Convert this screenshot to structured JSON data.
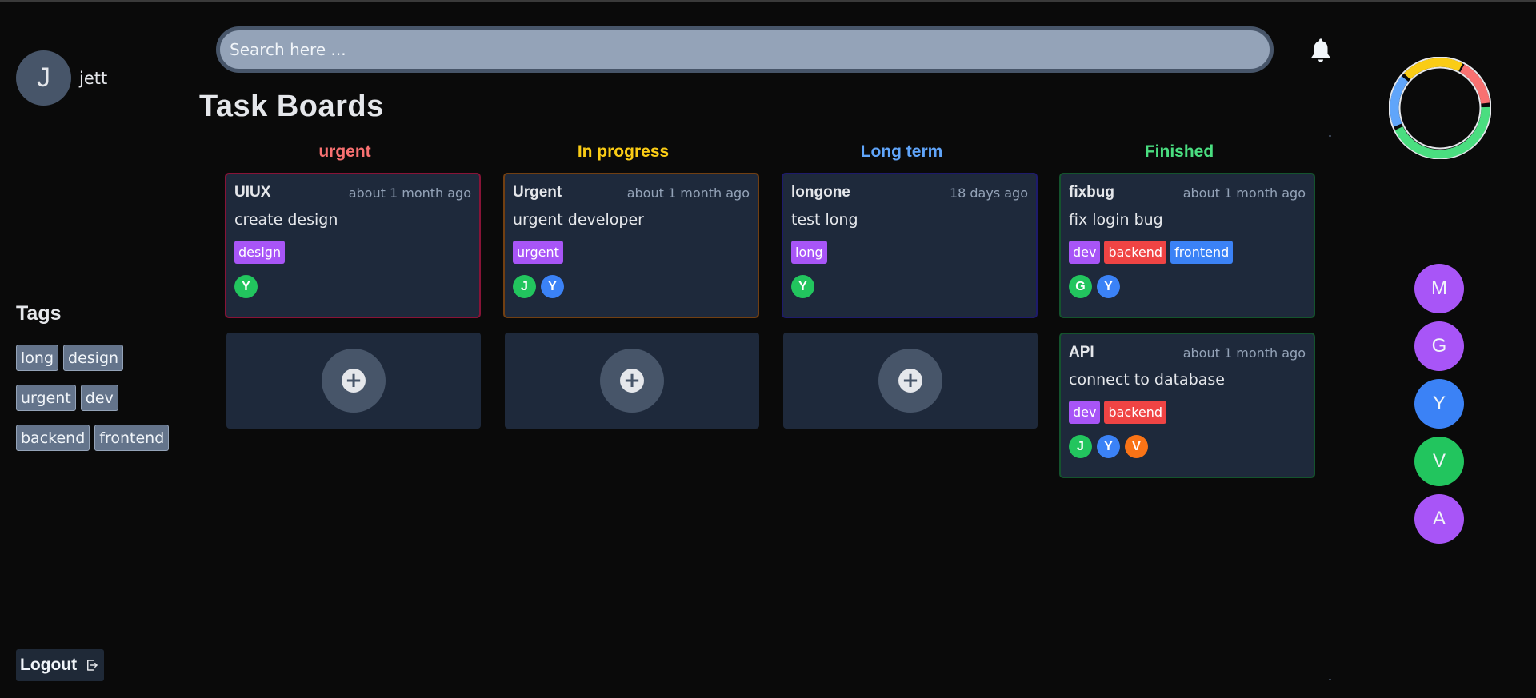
{
  "user": {
    "initial": "J",
    "name": "jett"
  },
  "search": {
    "placeholder": "Search here ..."
  },
  "icons": {
    "notification": "bell-icon",
    "logout": "logout-icon",
    "add": "plus-icon"
  },
  "page_title": "Task Boards",
  "sidebar": {
    "tags_title": "Tags",
    "tags": [
      "long",
      "design",
      "urgent",
      "dev",
      "backend",
      "frontend"
    ],
    "logout_label": "Logout"
  },
  "colors": {
    "urgent": "#f87171",
    "in_progress": "#facc15",
    "long_term": "#60a5fa",
    "finished": "#4ade80",
    "tag_design": "#a855f7",
    "tag_urgent": "#a855f7",
    "tag_long": "#a855f7",
    "tag_dev": "#a855f7",
    "tag_backend": "#ef4444",
    "tag_frontend": "#3b82f6",
    "avatar_green": "#22c55e",
    "avatar_blue": "#3b82f6",
    "avatar_orange": "#f97316",
    "avatar_purple": "#a855f7"
  },
  "columns": [
    {
      "title": "urgent",
      "cards": [
        {
          "title": "UIUX",
          "time": "about 1 month ago",
          "desc": "create design",
          "tags": [
            "design"
          ],
          "assignees": [
            "Y"
          ]
        }
      ]
    },
    {
      "title": "In progress",
      "cards": [
        {
          "title": "Urgent",
          "time": "about 1 month ago",
          "desc": "urgent developer",
          "tags": [
            "urgent"
          ],
          "assignees": [
            "J",
            "Y"
          ]
        }
      ]
    },
    {
      "title": "Long term",
      "cards": [
        {
          "title": "longone",
          "time": "18 days ago",
          "desc": "test long",
          "tags": [
            "long"
          ],
          "assignees": [
            "Y"
          ]
        }
      ]
    },
    {
      "title": "Finished",
      "cards": [
        {
          "title": "fixbug",
          "time": "about 1 month ago",
          "desc": "fix login bug",
          "tags": [
            "dev",
            "backend",
            "frontend"
          ],
          "assignees": [
            "G",
            "Y"
          ]
        },
        {
          "title": "API",
          "time": "about 1 month ago",
          "desc": "connect to database",
          "tags": [
            "dev",
            "backend"
          ],
          "assignees": [
            "J",
            "Y",
            "V"
          ]
        }
      ]
    }
  ],
  "members": [
    "M",
    "G",
    "Y",
    "V",
    "A"
  ]
}
